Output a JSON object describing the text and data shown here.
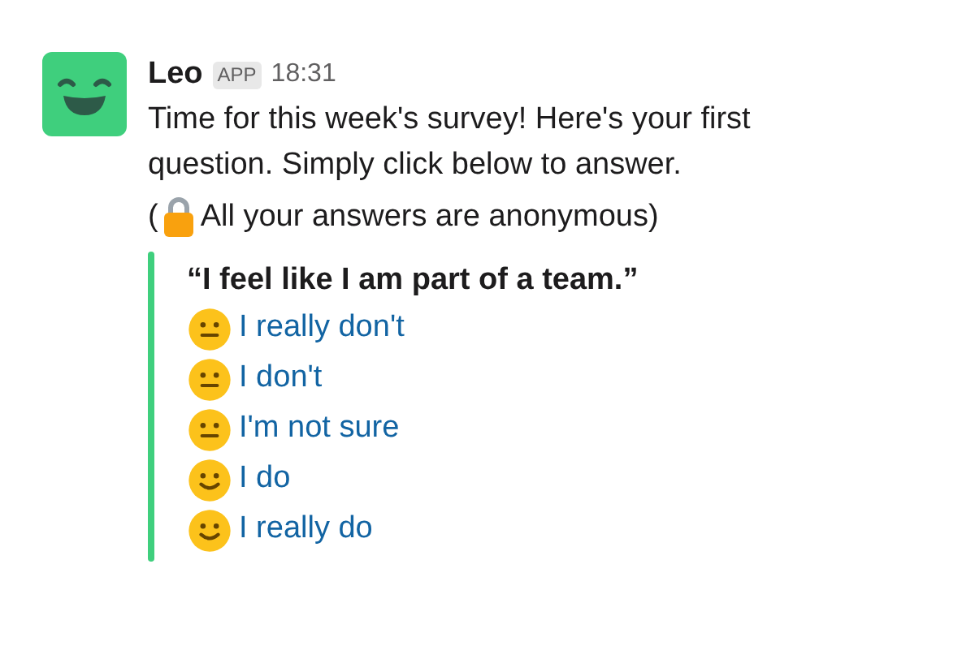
{
  "message": {
    "author": "Leo",
    "badge": "APP",
    "time": "18:31",
    "text_lines": [
      "Time for this week's survey! Here's your first",
      "question. Simply click below to answer."
    ],
    "note_open": "(",
    "note": "All your answers are anonymous)",
    "attachment": {
      "question": "“I feel like I am part of a team.”",
      "options": [
        {
          "label": "I really don't",
          "kind": "neutral"
        },
        {
          "label": "I don't",
          "kind": "neutral"
        },
        {
          "label": "I'm not sure",
          "kind": "neutral"
        },
        {
          "label": "I do",
          "kind": "smile"
        },
        {
          "label": "I really do",
          "kind": "smile"
        }
      ]
    }
  }
}
